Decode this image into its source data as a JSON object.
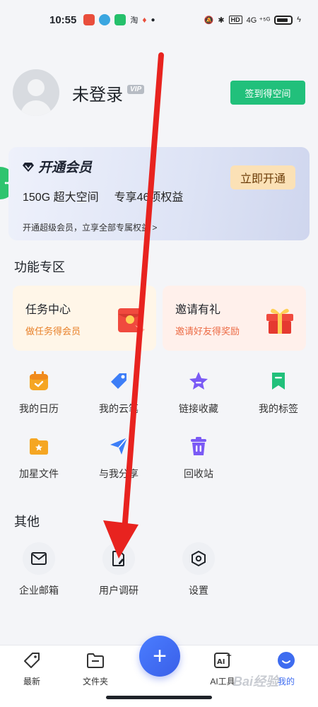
{
  "status_bar": {
    "time": "10:55",
    "network": "4G ⁺⁵ᴳ",
    "app_icon_colors": [
      "#e94e3c",
      "#3aa6e0",
      "#25c06b"
    ]
  },
  "profile": {
    "username": "未登录",
    "vip_tag": "VIP",
    "sign_button": "签到得空间"
  },
  "member_card": {
    "title": "开通会员",
    "features": [
      "150G 超大空间",
      "专享46项权益"
    ],
    "footer": "开通超级会员，立享全部专属权益 >",
    "open_button": "立即开通"
  },
  "features_section": {
    "title": "功能专区",
    "promos": [
      {
        "title": "任务中心",
        "subtitle": "做任务得会员"
      },
      {
        "title": "邀请有礼",
        "subtitle": "邀请好友得奖励"
      }
    ],
    "items": [
      {
        "label": "我的日历",
        "icon": "calendar-icon",
        "color": "#f5a623"
      },
      {
        "label": "我的云笔",
        "icon": "pen-tag-icon",
        "color": "#3d7ef7"
      },
      {
        "label": "链接收藏",
        "icon": "star-icon",
        "color": "#7a5af5"
      },
      {
        "label": "我的标签",
        "icon": "bookmark-icon",
        "color": "#21c07b"
      },
      {
        "label": "加星文件",
        "icon": "starred-folder-icon",
        "color": "#f5a623"
      },
      {
        "label": "与我分享",
        "icon": "share-plane-icon",
        "color": "#3d7ef7"
      },
      {
        "label": "回收站",
        "icon": "trash-icon",
        "color": "#7a5af5"
      }
    ]
  },
  "other_section": {
    "title": "其他",
    "items": [
      {
        "label": "企业邮箱",
        "icon": "mail-icon"
      },
      {
        "label": "用户调研",
        "icon": "survey-doc-icon"
      },
      {
        "label": "设置",
        "icon": "settings-hex-icon"
      }
    ]
  },
  "bottom_nav": {
    "items": [
      {
        "label": "最新",
        "icon": "tag-icon"
      },
      {
        "label": "文件夹",
        "icon": "folder-icon"
      },
      {
        "label": "AI工具",
        "icon": "ai-tool-icon"
      },
      {
        "label": "我的",
        "icon": "profile-smile-icon"
      }
    ],
    "active": "我的",
    "accent": "#3e6cf0"
  },
  "watermark": "Bai经验",
  "annotation_arrow_color": "#e8231f"
}
